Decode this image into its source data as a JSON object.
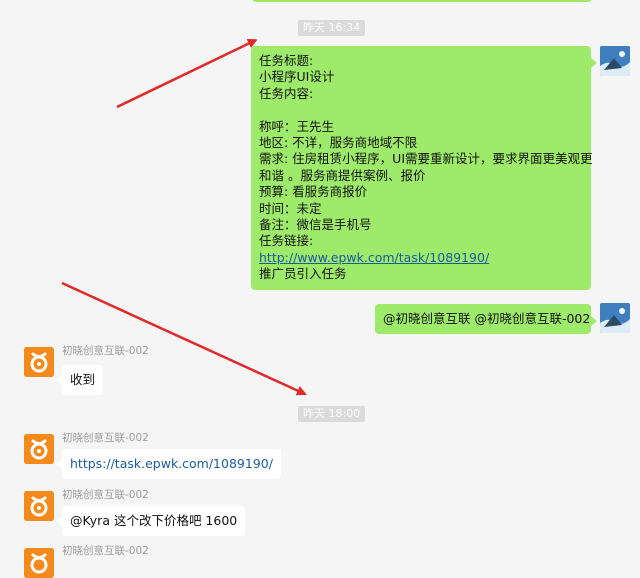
{
  "chat": {
    "time_badges": [
      "昨天 16:34",
      "昨天 18:00"
    ],
    "task_message": {
      "lines": [
        "任务标题:",
        "小程序UI设计",
        "任务内容:",
        "",
        "称呼：王先生",
        "地区: 不详，服务商地域不限",
        "需求: 住房租赁小程序，UI需要重新设计，要求界面更美观更",
        "和谐 。服务商提供案例、报价",
        "预算: 看服务商报价",
        "时间：未定",
        "备注：微信是手机号",
        "任务链接:"
      ],
      "link": "http://www.epwk.com/task/1089190/",
      "last_line": "推广员引入任务"
    },
    "mention_message": "@初晓创意互联 @初晓创意互联-002",
    "incoming": [
      {
        "sender": "初晓创意互联-002",
        "text": "收到"
      },
      {
        "sender": "初晓创意互联-002",
        "text": "https://task.epwk.com/1089190/"
      },
      {
        "sender": "初晓创意互联-002",
        "text": "@Kyra 这个改下价格吧 1600"
      },
      {
        "sender": "初晓创意互联-002",
        "text": ""
      }
    ],
    "colors": {
      "self_bubble": "#9eea6a",
      "other_bubble": "#ffffff",
      "background": "#f5f5f5",
      "annotation_arrow": "#e02a2a",
      "org_avatar": "#f38a1b"
    },
    "icons": {
      "self_avatar": "landscape-avatar-icon",
      "org_avatar": "knot-logo-icon"
    }
  }
}
